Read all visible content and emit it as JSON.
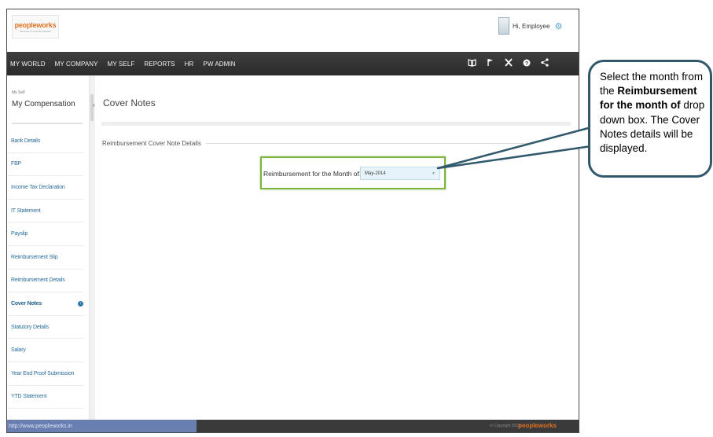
{
  "header": {
    "logo_text": "peopleworks",
    "logo_tagline": "PEOPLE IS OUR BUSINESS",
    "greeting": "Hi, Employee"
  },
  "navbar": {
    "items": [
      "MY WORLD",
      "MY COMPANY",
      "MY SELF",
      "REPORTS",
      "HR",
      "PW ADMIN"
    ],
    "icons": [
      "book-icon",
      "flag-icon",
      "tools-icon",
      "help-icon",
      "share-icon"
    ]
  },
  "sidebar": {
    "breadcrumb": "My Self",
    "title": "My Compensation",
    "items": [
      {
        "label": "Bank Details"
      },
      {
        "label": "FBP"
      },
      {
        "label": "Income Tax Declaration"
      },
      {
        "label": "IT Statement"
      },
      {
        "label": "Payslip"
      },
      {
        "label": "Reimbursement Slip"
      },
      {
        "label": "Reimbursement Details"
      },
      {
        "label": "Cover Notes",
        "active": true
      },
      {
        "label": "Statutory Details"
      },
      {
        "label": "Salary"
      },
      {
        "label": "Year End Proof Submission"
      },
      {
        "label": "YTD Statement"
      }
    ]
  },
  "main": {
    "page_title": "Cover Notes",
    "section_label": "Reimbursement Cover Note Details",
    "field_label": "Reimbursement for the Month of:",
    "month_value": "May-2014"
  },
  "footer": {
    "status_url": "http://www.peopleworks.in",
    "copyright": "© Copyright 2015",
    "logo_text": "peopleworks"
  },
  "callout": {
    "text_1": "Select the month from the",
    "text_bold": "Reimbursement for the month of",
    "text_2": "drop down box. The Cover Notes details will be displayed."
  },
  "colors": {
    "navbar_bg": "#333333",
    "link": "#2c6f9d",
    "highlight_border": "#79b43c",
    "callout_border": "#31596c",
    "status_bar": "#6a7fb1"
  }
}
